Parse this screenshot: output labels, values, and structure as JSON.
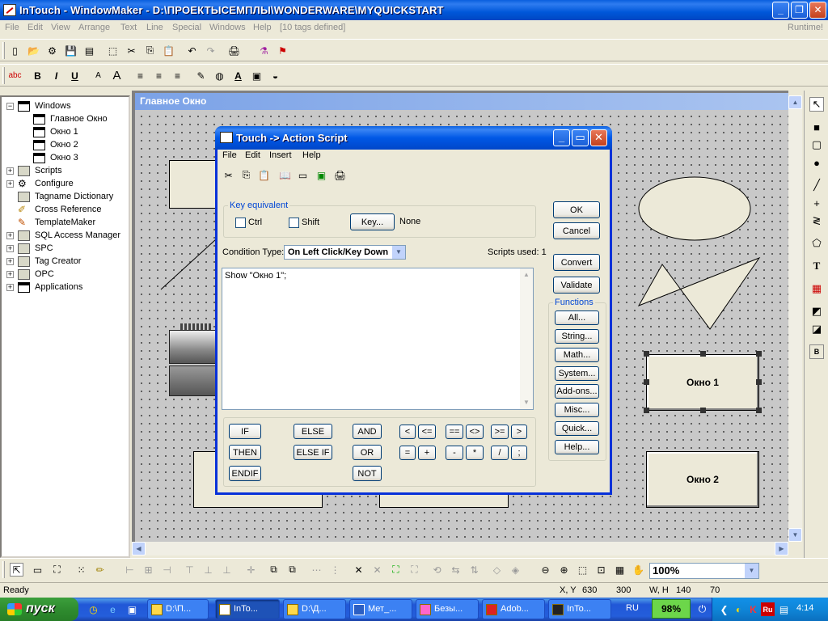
{
  "window": {
    "title": "InTouch - WindowMaker - D:\\ПРОЕКТЫСЕМПЛЫ\\WONDERWARE\\MYQUICKSTART",
    "minimize": "_",
    "maximize": "❐",
    "close": "✕"
  },
  "menu": {
    "items": [
      "File",
      "Edit",
      "View",
      "Arrange",
      "Text",
      "Line",
      "Special",
      "Windows",
      "Help",
      "[10 tags defined]"
    ],
    "runtime": "Runtime!"
  },
  "tree": {
    "items": [
      "Windows",
      "Главное Окно",
      "Окно 1",
      "Окно 2",
      "Окно 3",
      "Scripts",
      "Configure",
      "Tagname Dictionary",
      "Cross Reference",
      "TemplateMaker",
      "SQL Access Manager",
      "SPC",
      "Tag Creator",
      "OPC",
      "Applications"
    ]
  },
  "child": {
    "title": "Главное Окно",
    "btn1": "Окно 1",
    "btn2": "Окно 2"
  },
  "dialog": {
    "title": "Touch -> Action Script",
    "menu": [
      "File",
      "Edit",
      "Insert",
      "Help"
    ],
    "key_group": "Key equivalent",
    "ctrl": "Ctrl",
    "shift": "Shift",
    "key_button": "Key...",
    "key_value": "None",
    "condition_label": "Condition Type:",
    "condition_value": "On Left Click/Key Down",
    "scripts_used": "Scripts used: 1",
    "script_text": "Show \"Окно 1\";",
    "ok": "OK",
    "cancel": "Cancel",
    "convert": "Convert",
    "validate": "Validate",
    "functions_label": "Functions",
    "functions": [
      "All...",
      "String...",
      "Math...",
      "System...",
      "Add-ons...",
      "Misc...",
      "Quick...",
      "Help..."
    ],
    "keywords": [
      "IF",
      "THEN",
      "ENDIF",
      "ELSE",
      "ELSE IF",
      "AND",
      "OR",
      "NOT"
    ],
    "operators": [
      "<",
      "<=",
      "==",
      "<>",
      ">=",
      ">",
      "=",
      "+",
      "-",
      "*",
      "/",
      ";"
    ]
  },
  "bottombar": {
    "zoom": "100%"
  },
  "status": {
    "ready": "Ready",
    "xy_label": "X, Y",
    "x": "630",
    "y": "300",
    "wh_label": "W, H",
    "w": "140",
    "h": "70"
  },
  "taskbar": {
    "start": "пуск",
    "tasks": [
      "D:\\П...",
      "InTo...",
      "D:\\Д...",
      "Мет_...",
      "Безы...",
      "Adob...",
      "InTo..."
    ],
    "lang": "RU",
    "battery": "98%",
    "time": "4:14"
  },
  "colors": {
    "title_blue": "#0054e3",
    "dialog_border": "#0831d9",
    "canvas": "#c8c8c8",
    "battery_green": "#6cd64a"
  }
}
